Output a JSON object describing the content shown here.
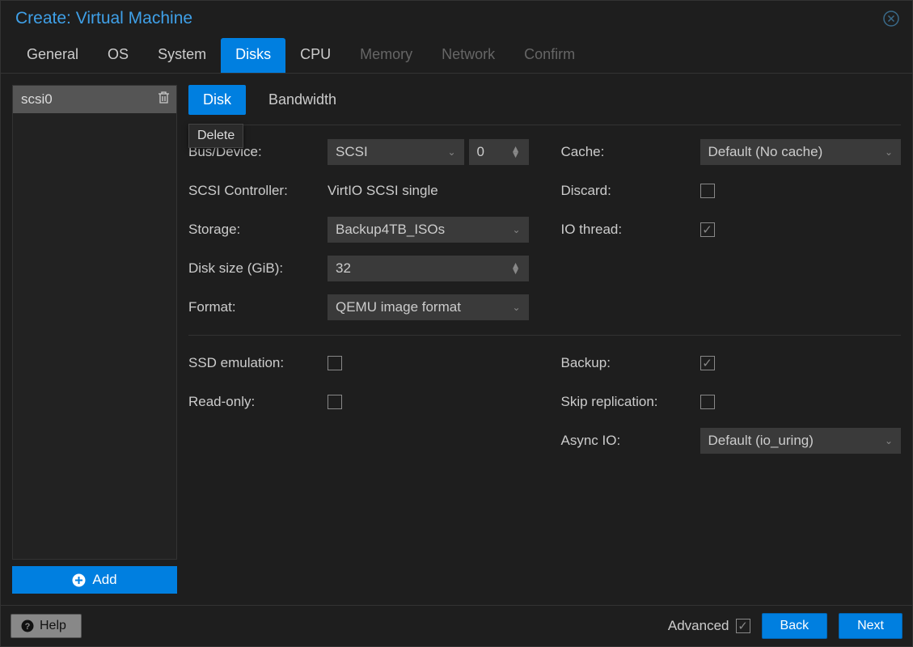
{
  "title": "Create: Virtual Machine",
  "tabs": [
    {
      "label": "General",
      "state": "enabled"
    },
    {
      "label": "OS",
      "state": "enabled"
    },
    {
      "label": "System",
      "state": "enabled"
    },
    {
      "label": "Disks",
      "state": "active"
    },
    {
      "label": "CPU",
      "state": "enabled"
    },
    {
      "label": "Memory",
      "state": "disabled"
    },
    {
      "label": "Network",
      "state": "disabled"
    },
    {
      "label": "Confirm",
      "state": "disabled"
    }
  ],
  "sidebar": {
    "items": [
      {
        "label": "scsi0"
      }
    ],
    "add_label": "Add"
  },
  "sub_tabs": {
    "disk": "Disk",
    "bandwidth": "Bandwidth"
  },
  "tooltip": "Delete",
  "form": {
    "bus_device_label": "Bus/Device:",
    "bus_device_bus": "SCSI",
    "bus_device_num": "0",
    "scsi_controller_label": "SCSI Controller:",
    "scsi_controller_value": "VirtIO SCSI single",
    "storage_label": "Storage:",
    "storage_value": "Backup4TB_ISOs",
    "disk_size_label": "Disk size (GiB):",
    "disk_size_value": "32",
    "format_label": "Format:",
    "format_value": "QEMU image format",
    "cache_label": "Cache:",
    "cache_value": "Default (No cache)",
    "discard_label": "Discard:",
    "io_thread_label": "IO thread:",
    "ssd_label": "SSD emulation:",
    "readonly_label": "Read-only:",
    "backup_label": "Backup:",
    "skip_repl_label": "Skip replication:",
    "async_io_label": "Async IO:",
    "async_io_value": "Default (io_uring)"
  },
  "footer": {
    "help": "Help",
    "advanced": "Advanced",
    "back": "Back",
    "next": "Next"
  }
}
